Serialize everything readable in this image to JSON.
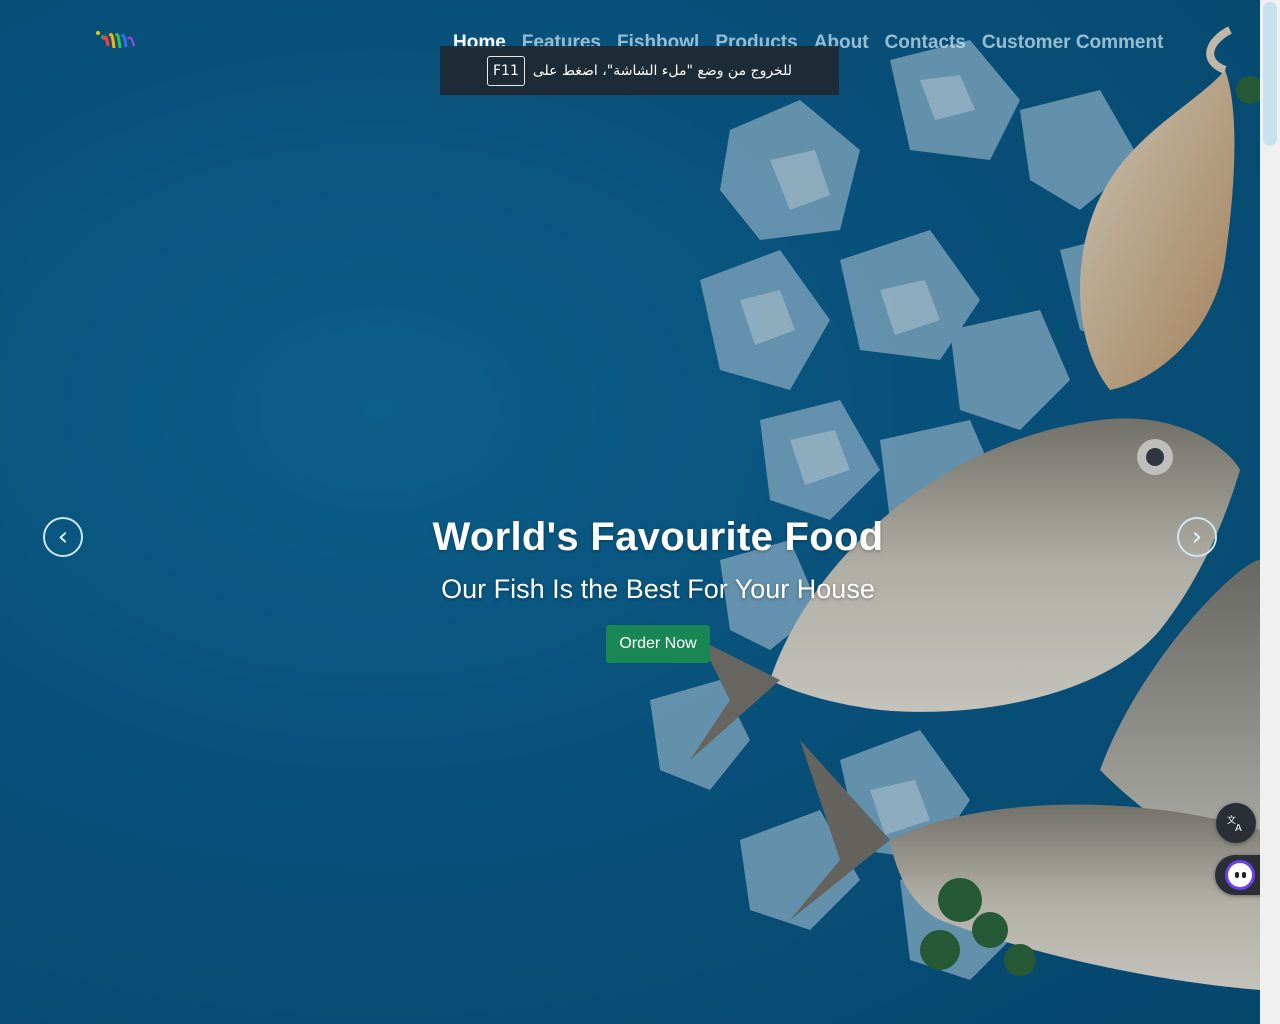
{
  "nav": {
    "items": [
      {
        "label": "Home",
        "active": true
      },
      {
        "label": "Features"
      },
      {
        "label": "Fishbowl"
      },
      {
        "label": "Products"
      },
      {
        "label": "About"
      },
      {
        "label": "Contacts"
      },
      {
        "label": "Customer Comment"
      }
    ]
  },
  "toast": {
    "message": "للخروج من وضع \"ملء الشاشة\"، اضغط على",
    "key": "F11"
  },
  "hero": {
    "title": "World's Favourite Food",
    "subtitle": "Our Fish Is the Best For Your House",
    "cta_label": "Order Now"
  },
  "carousel": {
    "prev_symbol": "‹",
    "next_symbol": "›"
  },
  "widgets": {
    "translate_icon": "translate-icon",
    "assistant_icon": "assistant-bot-icon"
  },
  "colors": {
    "hero_bg": "#0a5e8d",
    "cta_bg": "#198754",
    "toast_bg": "#1e2830"
  }
}
